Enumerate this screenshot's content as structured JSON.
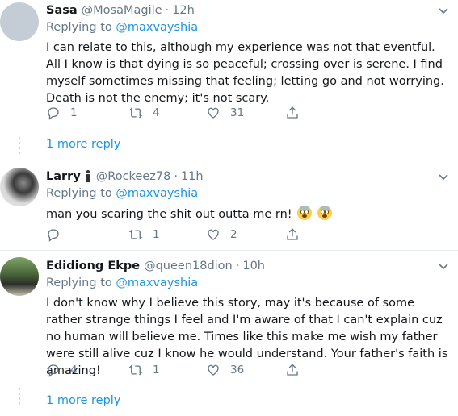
{
  "tweets": [
    {
      "name": "Sasa",
      "handle": "@MosaMagile",
      "time": "12h",
      "replying_prefix": "Replying to",
      "replying_to": "@maxvayshia",
      "text": "I can relate to this, although my experience was not that eventful. All I know is that dying is so peaceful; crossing over is serene. I find myself sometimes missing that feeling; letting go and not worrying. Death is not the enemy; it's not scary.",
      "replies": "1",
      "retweets": "4",
      "likes": "31",
      "more": "1 more reply"
    },
    {
      "name": "Larry",
      "handle": "@Rockeez78",
      "time": "11h",
      "replying_prefix": "Replying to",
      "replying_to": "@maxvayshia",
      "text": "man you scaring the shit out outta me rn!",
      "replies": "",
      "retweets": "1",
      "likes": "2"
    },
    {
      "name": "Edidiong Ekpe",
      "handle": "@queen18dion",
      "time": "10h",
      "replying_prefix": "Replying to",
      "replying_to": "@maxvayshia",
      "text": "I don't know why I believe this story, may it's because of some rather strange things I feel and I'm aware of that I can't explain cuz no human will believe me. Times like this make me wish my father were still alive cuz I know he would understand. Your father's faith is amazing!",
      "replies": "4",
      "retweets": "1",
      "likes": "36",
      "more": "1 more reply"
    }
  ],
  "icons": {
    "reply": "reply-icon",
    "retweet": "retweet-icon",
    "like": "heart-icon",
    "share": "share-icon",
    "menu": "chevron-down-icon"
  },
  "colors": {
    "link": "#1b95e0",
    "secondary": "#657786",
    "text": "#14171a",
    "divider": "#e6ecf0"
  }
}
